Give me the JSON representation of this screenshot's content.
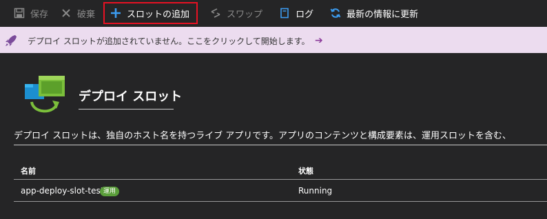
{
  "toolbar": {
    "save_label": "保存",
    "discard_label": "破棄",
    "add_slot_label": "スロットの追加",
    "swap_label": "スワップ",
    "log_label": "ログ",
    "refresh_label": "最新の情報に更新"
  },
  "banner": {
    "message": "デプロイ スロットが追加されていません。ここをクリックして開始します。",
    "arrow": "➔"
  },
  "section": {
    "title": "デプロイ スロット",
    "description": "デプロイ スロットは、独自のホスト名を持つライブ アプリです。アプリのコンテンツと構成要素は、運用スロットを含む、"
  },
  "table": {
    "headers": [
      "名前",
      "状態"
    ],
    "rows": [
      {
        "name": "app-deploy-slot-test",
        "badge": "運用",
        "status": "Running"
      }
    ]
  },
  "colors": {
    "background": "#252526",
    "banner_bg": "#ecdcef",
    "highlight_border": "#e81123",
    "accent_blue": "#3c9df2",
    "badge_green": "#5a9e3a"
  }
}
